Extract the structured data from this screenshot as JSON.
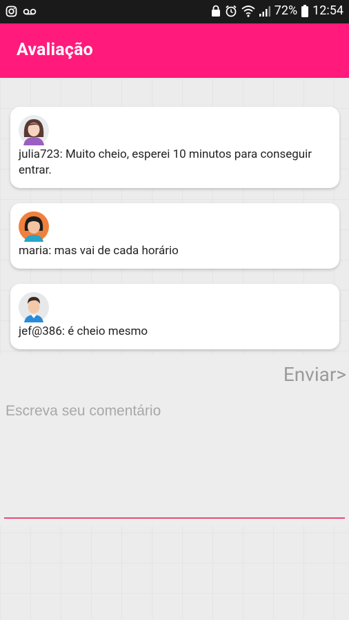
{
  "status_bar": {
    "battery": "72%",
    "time": "12:54"
  },
  "app_bar": {
    "title": "Avaliação"
  },
  "comments": [
    {
      "text": "julia723: Muito cheio, esperei 10 minutos para conseguir entrar.",
      "avatar": "female-avatar-icon"
    },
    {
      "text": "maria: mas vai de cada horário",
      "avatar": "female-avatar-icon"
    },
    {
      "text": "jef@386: é cheio mesmo",
      "avatar": "male-avatar-icon"
    }
  ],
  "composer": {
    "send_label": "Enviar>",
    "placeholder": "Escreva seu comentário"
  },
  "colors": {
    "primary": "#ff1a7c",
    "accent": "#e84877"
  }
}
